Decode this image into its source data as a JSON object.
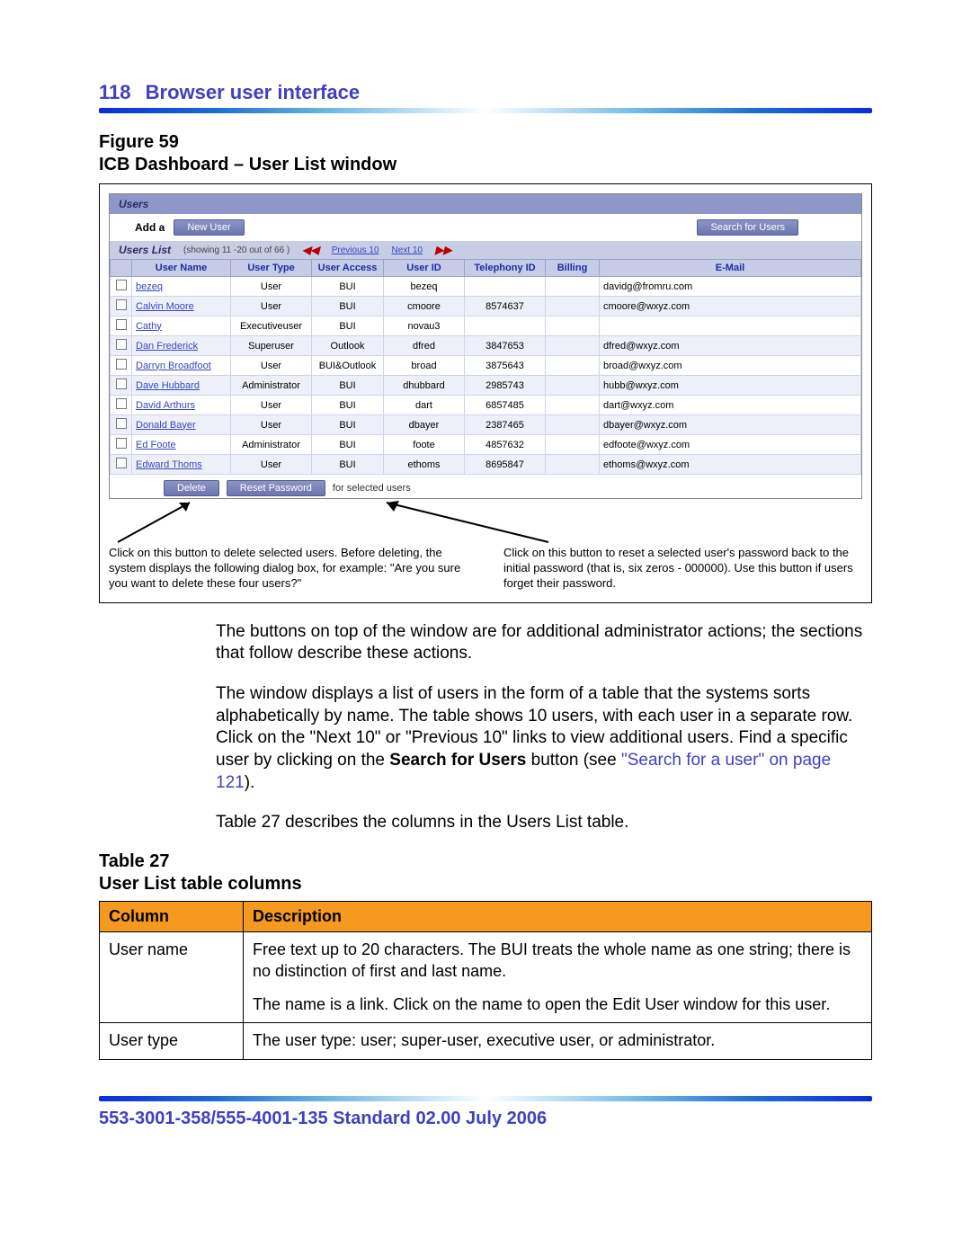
{
  "header": {
    "page": "118",
    "title": "Browser user interface"
  },
  "figure": {
    "label": "Figure 59",
    "caption": "ICB Dashboard – User List window"
  },
  "dashboard": {
    "section_users": "Users",
    "add_label": "Add a",
    "new_user_btn": "New User",
    "search_btn": "Search for Users",
    "list_hdr": "Users List",
    "list_meta": "(showing 11 -20 out of 66 )",
    "prev": "Previous 10",
    "next": "Next 10",
    "delete_btn": "Delete",
    "reset_btn": "Reset Password",
    "for_sel": "for selected users",
    "columns": [
      "User Name",
      "User Type",
      "User Access",
      "User ID",
      "Telephony ID",
      "Billing",
      "E-Mail"
    ],
    "rows": [
      {
        "name": "bezeq",
        "type": "User",
        "access": "BUI",
        "uid": "bezeq",
        "tel": "",
        "bill": "",
        "email": "davidg@fromru.com"
      },
      {
        "name": "Calvin Moore",
        "type": "User",
        "access": "BUI",
        "uid": "cmoore",
        "tel": "8574637",
        "bill": "",
        "email": "cmoore@wxyz.com"
      },
      {
        "name": "Cathy",
        "type": "Executiveuser",
        "access": "BUI",
        "uid": "novau3",
        "tel": "",
        "bill": "",
        "email": ""
      },
      {
        "name": "Dan Frederick",
        "type": "Superuser",
        "access": "Outlook",
        "uid": "dfred",
        "tel": "3847653",
        "bill": "",
        "email": "dfred@wxyz.com"
      },
      {
        "name": "Darryn Broadfoot",
        "type": "User",
        "access": "BUI&Outlook",
        "uid": "broad",
        "tel": "3875643",
        "bill": "",
        "email": "broad@wxyz.com"
      },
      {
        "name": "Dave Hubbard",
        "type": "Administrator",
        "access": "BUI",
        "uid": "dhubbard",
        "tel": "2985743",
        "bill": "",
        "email": "hubb@wxyz.com"
      },
      {
        "name": "David Arthurs",
        "type": "User",
        "access": "BUI",
        "uid": "dart",
        "tel": "6857485",
        "bill": "",
        "email": "dart@wxyz.com"
      },
      {
        "name": "Donald Bayer",
        "type": "User",
        "access": "BUI",
        "uid": "dbayer",
        "tel": "2387465",
        "bill": "",
        "email": "dbayer@wxyz.com"
      },
      {
        "name": "Ed Foote",
        "type": "Administrator",
        "access": "BUI",
        "uid": "foote",
        "tel": "4857632",
        "bill": "",
        "email": "edfoote@wxyz.com"
      },
      {
        "name": "Edward Thoms",
        "type": "User",
        "access": "BUI",
        "uid": "ethoms",
        "tel": "8695847",
        "bill": "",
        "email": "ethoms@wxyz.com"
      }
    ]
  },
  "annotations": {
    "left": "Click on this button to delete selected users. Before deleting, the system displays the following dialog box, for example: \"Are you sure you want to delete these four users?\"",
    "right": "Click on this button to reset a selected user's password back to the initial password (that is, six zeros - 000000). Use this button if users forget their password."
  },
  "paragraphs": {
    "p1": "The buttons on top of the window are for additional administrator actions; the sections that follow describe these actions.",
    "p2a": "The window displays a list of users in the form of a table that the systems sorts alphabetically by name. The table shows 10 users, with each user in a separate row. Click on the \"Next 10\" or \"Previous 10\" links to view additional users. Find a specific user by clicking on the ",
    "p2b": "Search for Users",
    "p2c": " button (see ",
    "p2link": "\"Search for a user\" on page 121",
    "p2d": ").",
    "p3": "Table 27 describes the columns in the Users List table."
  },
  "table": {
    "label": "Table 27",
    "caption": "User List table columns",
    "head": {
      "c1": "Column",
      "c2": "Description"
    },
    "rows": [
      {
        "col": "User name",
        "desc1": "Free text up to 20 characters. The BUI treats the whole name as one string; there is no distinction of first and last name.",
        "desc2": "The name is a link. Click on the name to open the Edit User window for this user."
      },
      {
        "col": "User type",
        "desc1": "The user type: user; super-user, executive user, or administrator.",
        "desc2": ""
      }
    ]
  },
  "footer": "553-3001-358/555-4001-135   Standard   02.00   July 2006"
}
